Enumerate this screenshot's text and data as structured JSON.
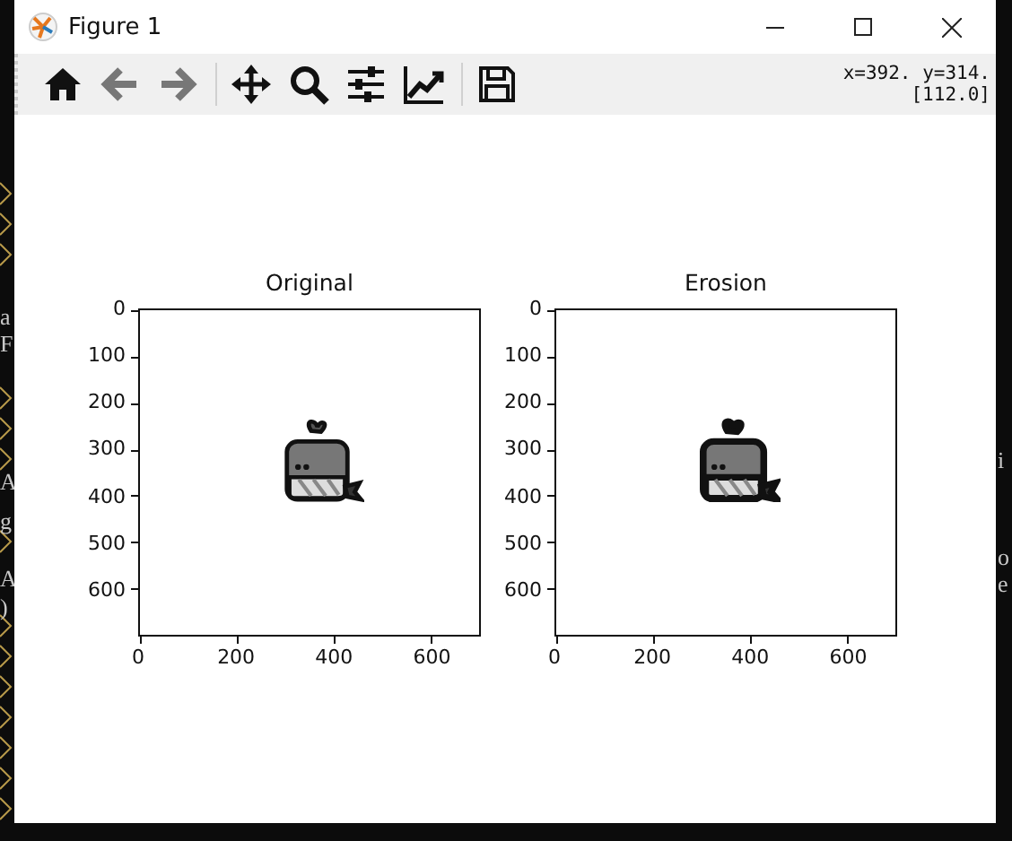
{
  "window": {
    "title": "Figure 1"
  },
  "toolbar": {
    "tools": [
      {
        "kind": "home",
        "disabled": false
      },
      {
        "kind": "back",
        "disabled": true
      },
      {
        "kind": "forward",
        "disabled": true
      },
      {
        "kind": "pan",
        "disabled": false
      },
      {
        "kind": "zoom",
        "disabled": false
      },
      {
        "kind": "subplots",
        "disabled": false
      },
      {
        "kind": "axes",
        "disabled": false
      },
      {
        "kind": "save",
        "disabled": false
      }
    ],
    "readout": [
      "x=392. y=314.",
      "[112.0]"
    ]
  },
  "axes": [
    {
      "title": "Original",
      "xticks": [
        "0",
        "200",
        "400",
        "600"
      ],
      "yticks": [
        "0",
        "100",
        "200",
        "300",
        "400",
        "500",
        "600"
      ],
      "image": {
        "kind": "picture"
      }
    },
    {
      "title": "Erosion",
      "xticks": [
        "0",
        "200",
        "400",
        "600"
      ],
      "yticks": [
        "0",
        "100",
        "200",
        "300",
        "400",
        "500",
        "600"
      ],
      "image": {
        "kind": "picture"
      }
    }
  ],
  "terminal": {
    "left": [
      "a",
      "F",
      "A",
      "g",
      "A",
      ")"
    ],
    "right": [
      "i",
      "o",
      "e"
    ]
  }
}
